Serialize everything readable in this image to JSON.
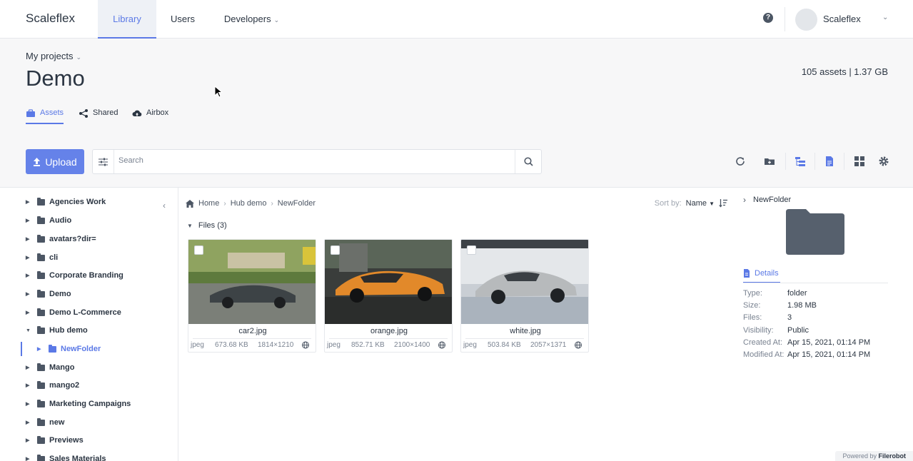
{
  "topnav": {
    "brand": "Scaleflex",
    "tabs": [
      {
        "label": "Library"
      },
      {
        "label": "Users"
      },
      {
        "label": "Developers"
      }
    ],
    "help": "?",
    "user": "Scaleflex"
  },
  "header": {
    "breadcrumb": "My projects",
    "title": "Demo",
    "stats": "105 assets | 1.37 GB",
    "tabs": [
      {
        "label": "Assets"
      },
      {
        "label": "Shared"
      },
      {
        "label": "Airbox"
      }
    ]
  },
  "toolbar": {
    "upload_label": "Upload",
    "search_placeholder": "Search"
  },
  "sidebar": {
    "items": [
      {
        "label": "Agencies Work"
      },
      {
        "label": "Audio"
      },
      {
        "label": "avatars?dir="
      },
      {
        "label": "cli"
      },
      {
        "label": "Corporate Branding"
      },
      {
        "label": "Demo"
      },
      {
        "label": "Demo L-Commerce"
      },
      {
        "label": "Hub demo"
      },
      {
        "label": "NewFolder"
      },
      {
        "label": "Mango"
      },
      {
        "label": "mango2"
      },
      {
        "label": "Marketing Campaigns"
      },
      {
        "label": "new"
      },
      {
        "label": "Previews"
      },
      {
        "label": "Sales Materials"
      }
    ]
  },
  "content": {
    "breadcrumbs": [
      "Home",
      "Hub demo",
      "NewFolder"
    ],
    "sort_label": "Sort by:",
    "sort_value": "Name",
    "files_header": "Files (3)",
    "files": [
      {
        "name": "car2.jpg",
        "ext": "jpeg",
        "size": "673.68 KB",
        "dims": "1814×1210"
      },
      {
        "name": "orange.jpg",
        "ext": "jpeg",
        "size": "852.71 KB",
        "dims": "2100×1400"
      },
      {
        "name": "white.jpg",
        "ext": "jpeg",
        "size": "503.84 KB",
        "dims": "2057×1371"
      }
    ]
  },
  "details": {
    "folder_name": "NewFolder",
    "tab_label": "Details",
    "rows": [
      {
        "key": "Type:",
        "value": "folder"
      },
      {
        "key": "Size:",
        "value": "1.98 MB"
      },
      {
        "key": "Files:",
        "value": "3"
      },
      {
        "key": "Visibility:",
        "value": "Public"
      },
      {
        "key": "Created At:",
        "value": "Apr 15, 2021, 01:14 PM"
      },
      {
        "key": "Modified At:",
        "value": "Apr 15, 2021, 01:14 PM"
      }
    ]
  },
  "footer": {
    "powered_prefix": "Powered by",
    "powered_brand": "Filerobot"
  }
}
